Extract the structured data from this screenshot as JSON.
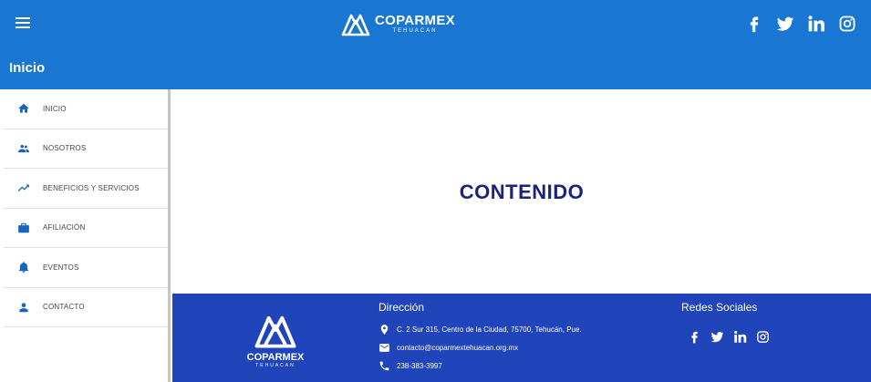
{
  "header": {
    "brand_name": "COPARMEX",
    "brand_sub": "TEHUACAN",
    "social_icons": [
      "facebook-icon",
      "twitter-icon",
      "linkedin-icon",
      "instagram-icon"
    ]
  },
  "page": {
    "title": "Inicio"
  },
  "sidebar": {
    "items": [
      {
        "icon": "home-icon",
        "label": "INICIO"
      },
      {
        "icon": "people-icon",
        "label": "NOSOTROS"
      },
      {
        "icon": "trending-up-icon",
        "label": "BENEFICIOS Y SERVICIOS"
      },
      {
        "icon": "briefcase-icon",
        "label": "AFILIACIÓN"
      },
      {
        "icon": "bell-icon",
        "label": "EVENTOS"
      },
      {
        "icon": "person-icon",
        "label": "CONTACTO"
      }
    ]
  },
  "main": {
    "placeholder": "CONTENIDO"
  },
  "footer": {
    "brand_name": "COPARMEX",
    "brand_sub": "TEHUACAN",
    "address_title": "Dirección",
    "address": "C. 2 Sur 315, Centro de la Ciudad, 75700, Tehucán, Pue.",
    "email": "contacto@coparmextehuacan.org.mx",
    "phone": "238-383-3997",
    "social_title": "Redes Sociales"
  },
  "colors": {
    "header_blue": "#1976d2",
    "footer_blue": "#2044b9",
    "content_text": "#1a237e",
    "icon_blue": "#1565c0"
  }
}
